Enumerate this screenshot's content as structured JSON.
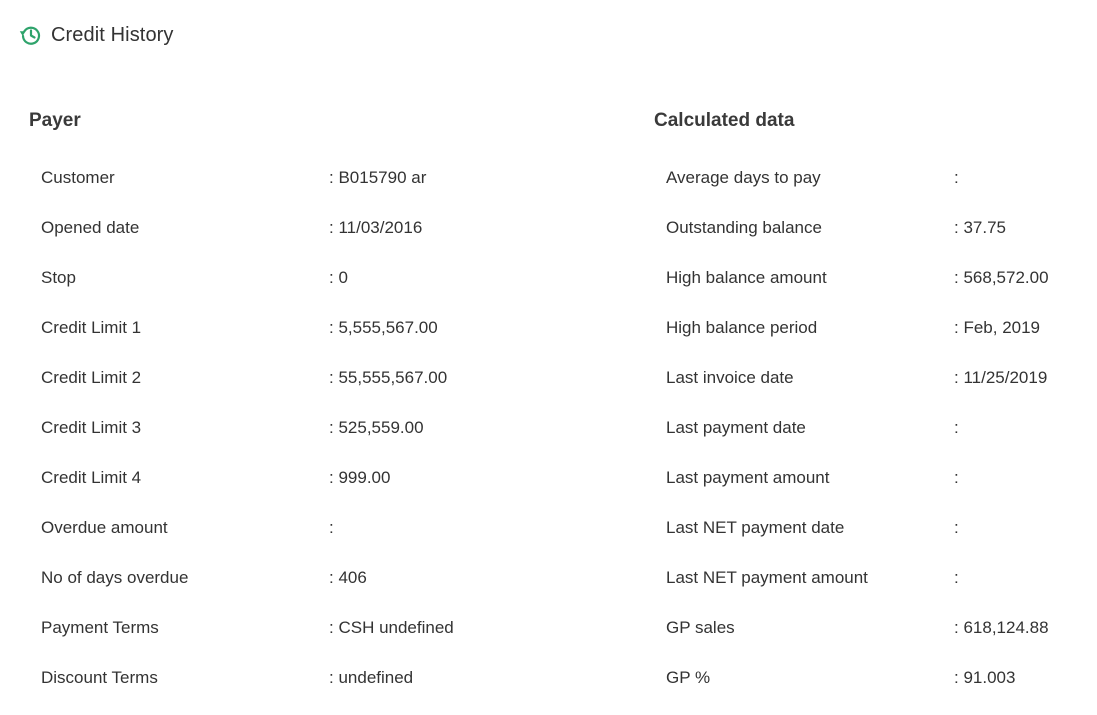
{
  "header": {
    "title": "Credit History",
    "icon": "history-icon",
    "accent_color": "#2ea36b"
  },
  "payer": {
    "heading": "Payer",
    "rows": [
      {
        "label": "Customer",
        "value": "B015790 ar"
      },
      {
        "label": "Opened date",
        "value": "11/03/2016"
      },
      {
        "label": "Stop",
        "value": "0"
      },
      {
        "label": "Credit Limit 1",
        "value": "5,555,567.00"
      },
      {
        "label": "Credit Limit 2",
        "value": "55,555,567.00"
      },
      {
        "label": "Credit Limit 3",
        "value": "525,559.00"
      },
      {
        "label": "Credit Limit 4",
        "value": "999.00"
      },
      {
        "label": "Overdue amount",
        "value": ""
      },
      {
        "label": "No of days overdue",
        "value": "406"
      },
      {
        "label": "Payment Terms",
        "value": "CSH undefined"
      },
      {
        "label": "Discount Terms",
        "value": "undefined"
      }
    ]
  },
  "calculated": {
    "heading": "Calculated data",
    "rows": [
      {
        "label": "Average days to pay",
        "value": ""
      },
      {
        "label": "Outstanding balance",
        "value": "37.75"
      },
      {
        "label": "High balance amount",
        "value": "568,572.00"
      },
      {
        "label": "High balance period",
        "value": "Feb, 2019"
      },
      {
        "label": "Last invoice date",
        "value": "11/25/2019"
      },
      {
        "label": "Last payment date",
        "value": ""
      },
      {
        "label": "Last payment amount",
        "value": ""
      },
      {
        "label": "Last NET payment date",
        "value": ""
      },
      {
        "label": "Last NET payment amount",
        "value": ""
      },
      {
        "label": "GP sales",
        "value": "618,124.88"
      },
      {
        "label": "GP %",
        "value": "91.003"
      }
    ]
  }
}
